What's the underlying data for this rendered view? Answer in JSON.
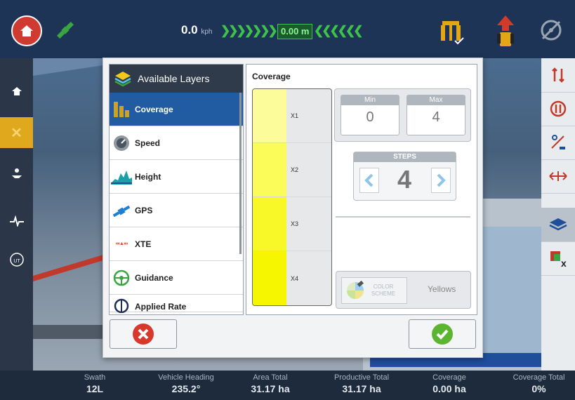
{
  "topbar": {
    "speed_value": "0.0",
    "speed_unit": "kph",
    "offset": "0.00 m"
  },
  "bottombar": {
    "stats": [
      {
        "label": "Swath",
        "value": "12L"
      },
      {
        "label": "Vehicle Heading",
        "value": "235.2°"
      },
      {
        "label": "Area Total",
        "value": "31.17 ha"
      },
      {
        "label": "Productive Total",
        "value": "31.17 ha"
      },
      {
        "label": "Coverage",
        "value": "0.00 ha"
      },
      {
        "label": "Coverage Total",
        "value": "0%"
      }
    ]
  },
  "modal": {
    "layers_title": "Available Layers",
    "layers": [
      {
        "label": "Coverage",
        "icon": "coverage-icon"
      },
      {
        "label": "Speed",
        "icon": "speed-icon"
      },
      {
        "label": "Height",
        "icon": "height-icon"
      },
      {
        "label": "GPS",
        "icon": "gps-icon"
      },
      {
        "label": "XTE",
        "icon": "xte-icon"
      },
      {
        "label": "Guidance",
        "icon": "guidance-icon"
      },
      {
        "label": "Applied Rate",
        "icon": "applied-rate-icon"
      }
    ],
    "coverage": {
      "title": "Coverage",
      "legend": [
        {
          "label": "X1",
          "color": "#fcfc9a"
        },
        {
          "label": "X2",
          "color": "#fbfb5a"
        },
        {
          "label": "X3",
          "color": "#f8f828"
        },
        {
          "label": "X4",
          "color": "#f6f600"
        }
      ],
      "min_label": "Min",
      "min_value": "0",
      "max_label": "Max",
      "max_value": "4",
      "steps_label": "STEPS",
      "steps_value": "4",
      "color_scheme_label": "COLOR SCHEME",
      "color_scheme_value": "Yellows"
    }
  },
  "colors": {
    "accent": "#215ba1",
    "topbar": "#1d3456",
    "cancel": "#d9382d",
    "confirm": "#5cb531"
  }
}
